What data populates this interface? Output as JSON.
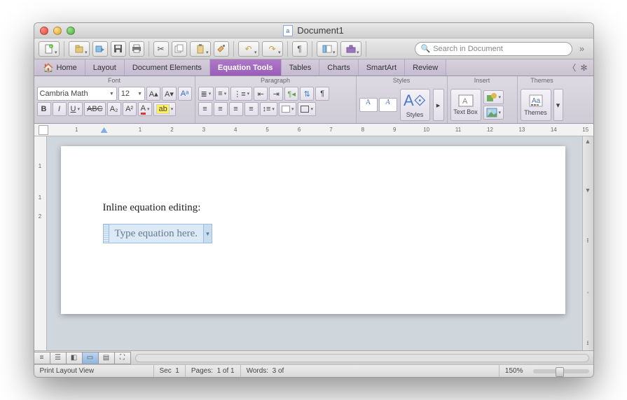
{
  "title": "Document1",
  "search_placeholder": "Search in Document",
  "tabs": {
    "home": "Home",
    "layout": "Layout",
    "doc_elements": "Document Elements",
    "equation_tools": "Equation Tools",
    "tables": "Tables",
    "charts": "Charts",
    "smartart": "SmartArt",
    "review": "Review"
  },
  "ribbon": {
    "font_group": "Font",
    "paragraph_group": "Paragraph",
    "styles_group": "Styles",
    "insert_group": "Insert",
    "themes_group": "Themes",
    "font_name": "Cambria Math",
    "font_size": "12",
    "styles_btn": "Styles",
    "textbox_btn": "Text Box",
    "themes_btn": "Themes"
  },
  "ruler_h": [
    "1",
    "",
    "1",
    "2",
    "3",
    "4",
    "5",
    "6",
    "7",
    "8",
    "9",
    "10",
    "11",
    "12",
    "13",
    "14",
    "15"
  ],
  "ruler_v": [
    "",
    "1",
    "",
    "1",
    "2"
  ],
  "document": {
    "line1": "Inline equation editing:",
    "equation_placeholder": "Type equation here."
  },
  "status": {
    "view_label": "Print Layout View",
    "sec_label": "Sec",
    "sec_val": "1",
    "pages_label": "Pages:",
    "pages_val": "1 of 1",
    "words_label": "Words:",
    "words_val": "3 of",
    "zoom": "150%"
  }
}
